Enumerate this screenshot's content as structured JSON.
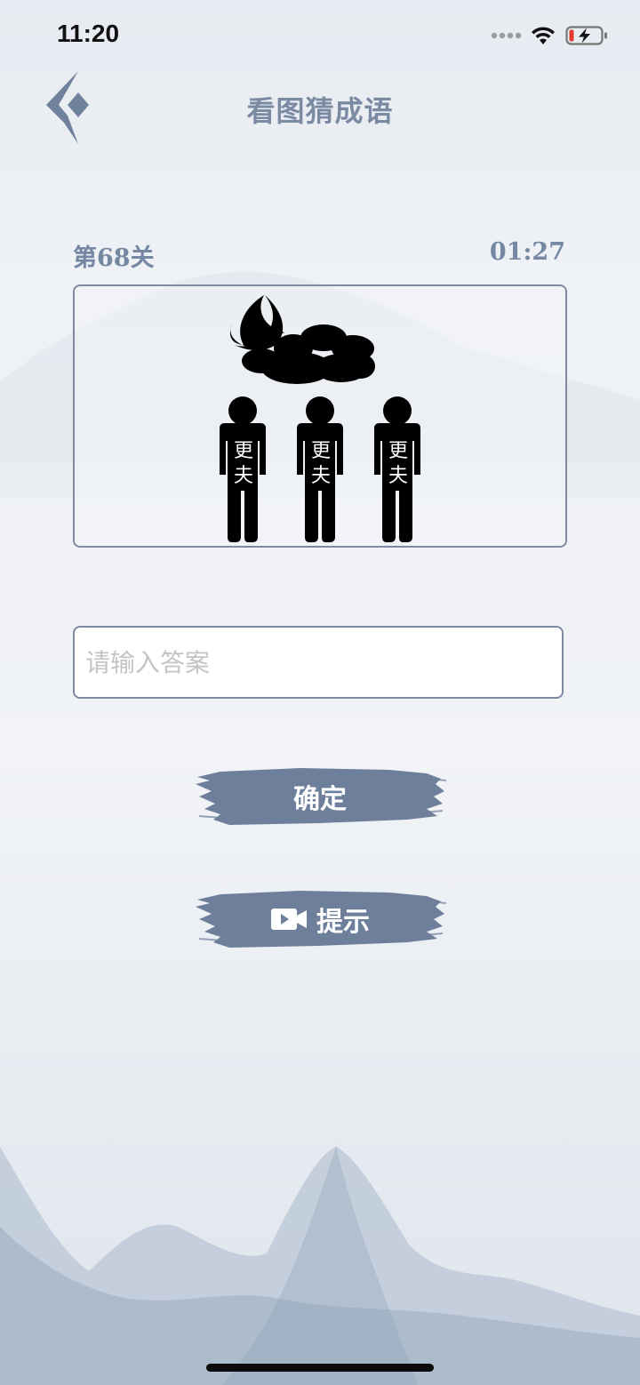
{
  "status_bar": {
    "time": "11:20",
    "icons": [
      "signal-icon",
      "wifi-icon",
      "battery-charging-icon"
    ]
  },
  "header": {
    "title": "看图猜成语",
    "back_icon": "back-arrow-icon"
  },
  "level": {
    "label": "第68关",
    "timer": "01:27"
  },
  "puzzle": {
    "figure_label_top": "更",
    "figure_label_bottom": "夫",
    "figures": [
      {
        "top": "更",
        "bottom": "夫"
      },
      {
        "top": "更",
        "bottom": "夫"
      },
      {
        "top": "更",
        "bottom": "夫"
      }
    ],
    "icons": [
      "moon-icon",
      "cloud-icon",
      "person-icon"
    ]
  },
  "answer": {
    "placeholder": "请输入答案",
    "value": ""
  },
  "buttons": {
    "confirm_label": "确定",
    "hint_label": "提示",
    "hint_icon": "video-camera-icon"
  },
  "colors": {
    "accent": "#6e7f9b",
    "title": "#7a8aa3",
    "border": "#7d8aa0"
  }
}
